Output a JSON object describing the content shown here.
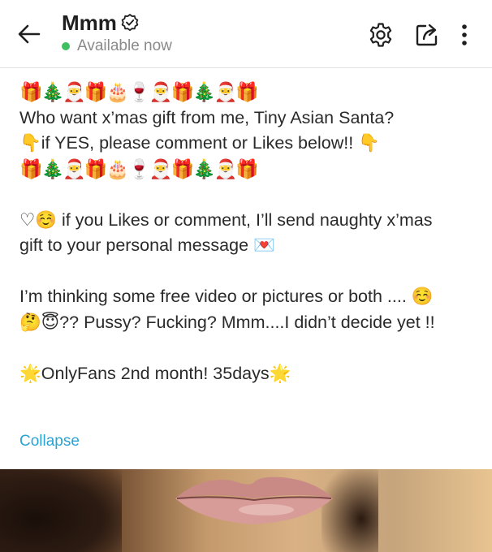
{
  "header": {
    "title": "Mmm",
    "status": "Available now",
    "status_color": "#3fbf5f",
    "icons": [
      "back-arrow-icon",
      "verified-badge-icon",
      "settings-gear-icon",
      "share-icon",
      "more-vertical-icon"
    ]
  },
  "post": {
    "emoji_line_1": "🎁🎄🎅🎁🎂🍷🎅🎁🎄🎅🎁",
    "line_1": "Who want x’mas gift from me, Tiny Asian Santa?",
    "line_2": "👇if YES, please comment or Likes below!! 👇",
    "emoji_line_2": "🎁🎄🎅🎁🎂🍷🎅🎁🎄🎅🎁",
    "line_3": "♡☺️ if you Likes or comment, I’ll send naughty x’mas",
    "line_4": "gift to your personal message 💌",
    "line_5": "I’m thinking some free video or pictures or both .... ☺️",
    "line_6": "🤔😇?? Pussy? Fucking? Mmm....I didn’t decide yet !!",
    "line_7": "🌟OnlyFans 2nd month! 35days🌟",
    "collapse_label": "Collapse",
    "link_color": "#2aa3d6"
  }
}
